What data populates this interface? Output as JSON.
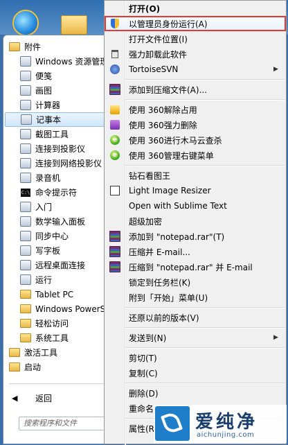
{
  "start_menu": {
    "items": [
      {
        "label": "附件",
        "icon": "folder-icon",
        "level": 0
      },
      {
        "label": "Windows 资源管理器",
        "icon": "explorer-icon",
        "level": 1
      },
      {
        "label": "便笺",
        "icon": "sticky-notes-icon",
        "level": 1
      },
      {
        "label": "画图",
        "icon": "paint-icon",
        "level": 1
      },
      {
        "label": "计算器",
        "icon": "calculator-icon",
        "level": 1
      },
      {
        "label": "记事本",
        "icon": "notepad-icon",
        "level": 1,
        "selected": true
      },
      {
        "label": "截图工具",
        "icon": "snipping-tool-icon",
        "level": 1
      },
      {
        "label": "连接到投影仪",
        "icon": "projector-icon",
        "level": 1
      },
      {
        "label": "连接到网络投影仪",
        "icon": "network-projector-icon",
        "level": 1
      },
      {
        "label": "录音机",
        "icon": "microphone-icon",
        "level": 1
      },
      {
        "label": "命令提示符",
        "icon": "command-prompt-icon",
        "level": 1
      },
      {
        "label": "入门",
        "icon": "getting-started-icon",
        "level": 1
      },
      {
        "label": "数学输入面板",
        "icon": "math-input-icon",
        "level": 1
      },
      {
        "label": "同步中心",
        "icon": "sync-center-icon",
        "level": 1
      },
      {
        "label": "写字板",
        "icon": "wordpad-icon",
        "level": 1
      },
      {
        "label": "远程桌面连接",
        "icon": "remote-desktop-icon",
        "level": 1
      },
      {
        "label": "运行",
        "icon": "run-icon",
        "level": 1
      },
      {
        "label": "Tablet PC",
        "icon": "folder-icon",
        "level": 1
      },
      {
        "label": "Windows PowerS",
        "icon": "folder-icon",
        "level": 1
      },
      {
        "label": "轻松访问",
        "icon": "folder-icon",
        "level": 1
      },
      {
        "label": "系统工具",
        "icon": "folder-icon",
        "level": 1
      },
      {
        "label": "激活工具",
        "icon": "folder-icon",
        "level": 0
      },
      {
        "label": "启动",
        "icon": "folder-icon",
        "level": 0
      }
    ],
    "back_label": "返回",
    "back_icon": "back-arrow-icon",
    "search_placeholder": "搜索程序和文件"
  },
  "context_menu": {
    "items": [
      {
        "type": "item",
        "label": "打开(O)",
        "bold": true,
        "icon": ""
      },
      {
        "type": "item",
        "label": "以管理员身份运行(A)",
        "icon": "uac-shield-icon",
        "highlight": true
      },
      {
        "type": "item",
        "label": "打开文件位置(I)",
        "icon": ""
      },
      {
        "type": "item",
        "label": "强力卸载此软件",
        "icon": "trash-icon"
      },
      {
        "type": "item",
        "label": "TortoiseSVN",
        "icon": "tortoisesvn-icon",
        "submenu": true
      },
      {
        "type": "separator"
      },
      {
        "type": "item",
        "label": "添加到压缩文件(A)...",
        "icon": "winrar-icon"
      },
      {
        "type": "separator"
      },
      {
        "type": "item",
        "label": "使用 360解除占用",
        "icon": "unlock-360-icon"
      },
      {
        "type": "item",
        "label": "使用 360强力删除",
        "icon": "delete-360-icon"
      },
      {
        "type": "item",
        "label": "使用 360进行木马云查杀",
        "icon": "antivirus-360-icon"
      },
      {
        "type": "item",
        "label": "使用 360管理右键菜单",
        "icon": "menu-manager-360-icon"
      },
      {
        "type": "separator"
      },
      {
        "type": "item",
        "label": "钻石看图王",
        "icon": ""
      },
      {
        "type": "item",
        "label": "Light Image Resizer",
        "icon": "image-resizer-icon"
      },
      {
        "type": "item",
        "label": "Open with Sublime Text",
        "icon": ""
      },
      {
        "type": "item",
        "label": "超级加密",
        "icon": ""
      },
      {
        "type": "item",
        "label": "添加到 \"notepad.rar\"(T)",
        "icon": "winrar-icon"
      },
      {
        "type": "item",
        "label": "压缩并 E-mail...",
        "icon": "winrar-icon"
      },
      {
        "type": "item",
        "label": "压缩到 \"notepad.rar\" 并 E-mail",
        "icon": "winrar-icon"
      },
      {
        "type": "item",
        "label": "锁定到任务栏(K)",
        "icon": ""
      },
      {
        "type": "item",
        "label": "附到「开始」菜单(U)",
        "icon": ""
      },
      {
        "type": "separator"
      },
      {
        "type": "item",
        "label": "还原以前的版本(V)",
        "icon": ""
      },
      {
        "type": "separator"
      },
      {
        "type": "item",
        "label": "发送到(N)",
        "icon": "",
        "submenu": true
      },
      {
        "type": "separator"
      },
      {
        "type": "item",
        "label": "剪切(T)",
        "icon": ""
      },
      {
        "type": "item",
        "label": "复制(C)",
        "icon": ""
      },
      {
        "type": "separator"
      },
      {
        "type": "item",
        "label": "删除(D)",
        "icon": ""
      },
      {
        "type": "item",
        "label": "重命名",
        "icon": ""
      },
      {
        "type": "separator"
      },
      {
        "type": "item",
        "label": "属性(R)",
        "icon": ""
      }
    ]
  },
  "watermark": {
    "title": "爱纯净",
    "url": "aichunjing.com"
  },
  "colors": {
    "highlight_border": "#e53935",
    "menu_background": "#f0f0f0",
    "selection": "#cfe6fb"
  }
}
